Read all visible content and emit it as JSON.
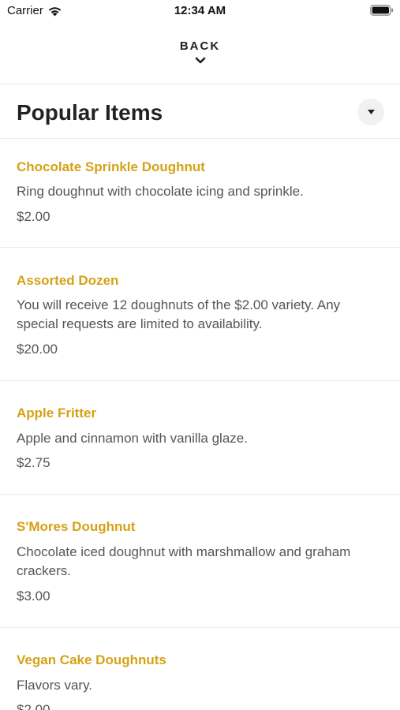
{
  "status_bar": {
    "carrier": "Carrier",
    "time": "12:34 AM",
    "wifi_icon": "wifi-icon",
    "battery_icon": "battery-full-icon"
  },
  "nav": {
    "back_label": "BACK",
    "back_icon": "chevron-down-icon"
  },
  "section": {
    "title": "Popular Items",
    "toggle_icon": "caret-down-icon"
  },
  "colors": {
    "accent": "#d4a216",
    "text_primary": "#222222",
    "text_secondary": "#555555",
    "divider": "#ececec"
  },
  "items": [
    {
      "name": "Chocolate Sprinkle Doughnut",
      "description": "Ring doughnut with chocolate icing and sprinkle.",
      "price": "$2.00"
    },
    {
      "name": "Assorted Dozen",
      "description": "You will receive 12 doughnuts of the $2.00 variety. Any special requests are limited to availability.",
      "price": "$20.00"
    },
    {
      "name": "Apple Fritter",
      "description": "Apple and cinnamon with vanilla glaze.",
      "price": "$2.75"
    },
    {
      "name": "S'Mores Doughnut",
      "description": "Chocolate iced doughnut with marshmallow and graham crackers.",
      "price": "$3.00"
    },
    {
      "name": "Vegan Cake Doughnuts",
      "description": "Flavors vary.",
      "price": "$2.00"
    }
  ]
}
